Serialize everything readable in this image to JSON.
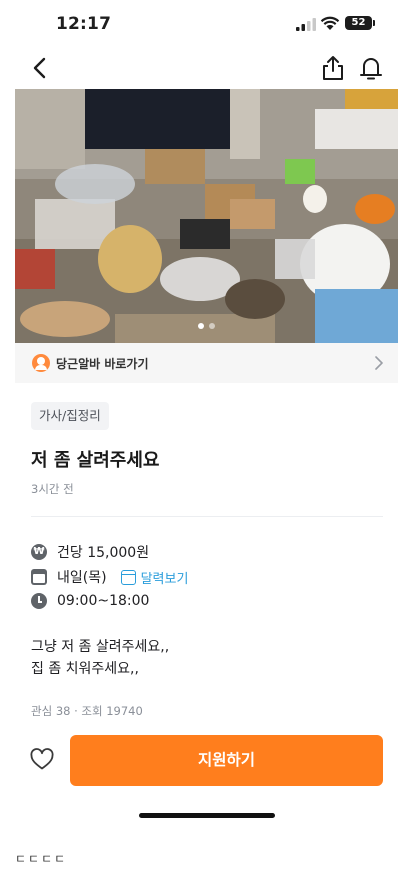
{
  "status_bar": {
    "time": "12:17",
    "battery": "52",
    "icons": [
      "cellular-signal-icon",
      "wifi-icon",
      "battery-icon"
    ]
  },
  "nav": {
    "icons": [
      "chevron-left-icon",
      "share-icon",
      "bell-icon"
    ]
  },
  "gallery": {
    "photo": "cluttered-room-photo",
    "page_count": 2,
    "active_index": 1
  },
  "shortcut": {
    "label": "당근알바 바로가기",
    "icons": [
      "profile-circle-icon",
      "chevron-right-icon"
    ]
  },
  "post": {
    "category": "가사/집정리",
    "title": "저 좀 살려주세요",
    "time_ago": "3시간 전",
    "pay": "건당 15,000원",
    "date": "내일(목)",
    "calendar_link": "달력보기",
    "hours": "09:00~18:00",
    "description_lines": [
      "그냥 저 좀 살려주세요,,",
      "집 좀 치워주세요,,"
    ],
    "stats": "관심 38 · 조회 19740"
  },
  "bottom": {
    "apply_label": "지원하기",
    "accent_color": "#ff7e1d"
  },
  "caption": "ㄷㄷㄷㄷ"
}
